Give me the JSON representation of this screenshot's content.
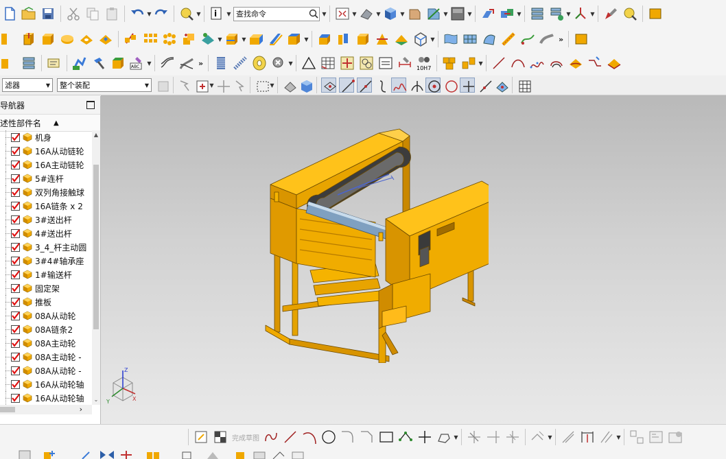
{
  "toolbar": {
    "search_text": "查找命令",
    "filter_label": "滤器",
    "assembly_select": "整个装配",
    "tolerance_label": "10H7",
    "overflow_chevron": "»"
  },
  "navigator": {
    "title": "导航器",
    "column_header": "述性部件名",
    "sort_arrow": "▲",
    "parts": [
      "机身",
      "16A从动链轮",
      "16A主动链轮",
      "5#连杆",
      "双列角接触球",
      "16A链条 x 2",
      "3#送出杆",
      "4#送出杆",
      "3_4_杆主动圆",
      "3#4#轴承座",
      "1#输送杆",
      "固定架",
      "推板",
      "08A从动轮",
      "08A链条2",
      "08A主动轮",
      "08A主动轮 -",
      "08A从动轮 -",
      "16A从动轮轴",
      "16A从动轮轴"
    ],
    "scroll_right": "›",
    "scroll_down": "⌄"
  },
  "sketch_toolbar": {
    "finish_sketch": "完成草图"
  },
  "triad": {
    "x": "X",
    "y": "Y",
    "z": "Z"
  },
  "colors": {
    "accent_orange": "#f0a800",
    "check_red": "#e01010",
    "viewport_top": "#b9b9b9",
    "viewport_bottom": "#e9e9e9"
  }
}
